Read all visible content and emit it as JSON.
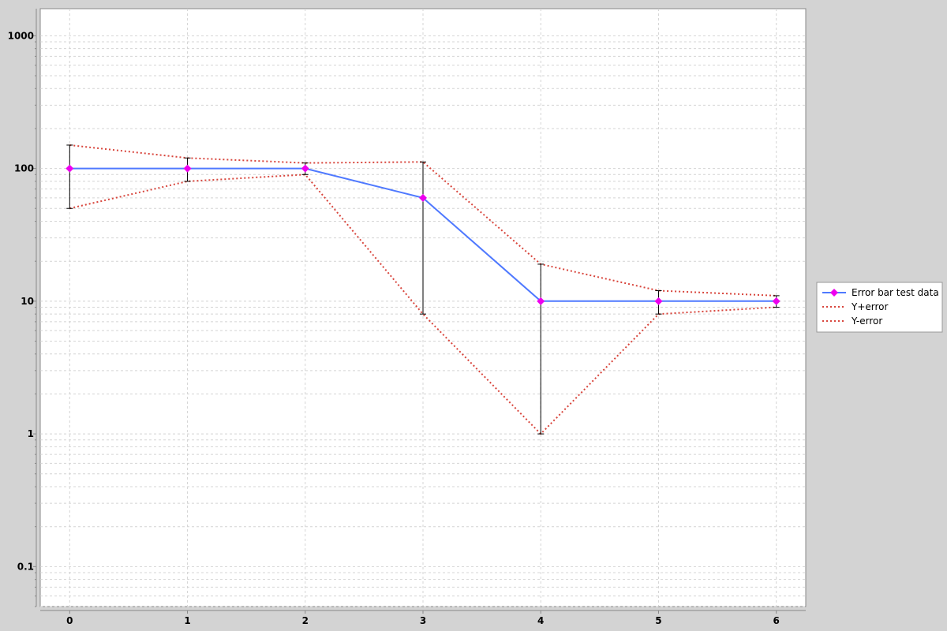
{
  "chart_data": {
    "type": "line",
    "title": "",
    "xlabel": "",
    "ylabel": "",
    "y_scale": "log",
    "xlim": [
      -0.25,
      6.25
    ],
    "ylim": [
      0.05,
      1600
    ],
    "grid": true,
    "legend_placement": "right",
    "x_ticks": [
      "0",
      "1",
      "2",
      "3",
      "4",
      "5",
      "6"
    ],
    "y_ticks": [
      {
        "value": 0.1,
        "label": "0.1"
      },
      {
        "value": 1,
        "label": "1"
      },
      {
        "value": 10,
        "label": "10"
      },
      {
        "value": 100,
        "label": "100"
      },
      {
        "value": 1000,
        "label": "1000"
      }
    ],
    "x": [
      0,
      1,
      2,
      3,
      4,
      5,
      6
    ],
    "series": [
      {
        "name": "Error bar test data",
        "values": [
          100,
          100,
          100,
          60,
          10,
          10,
          10
        ],
        "color": "#4f79ff",
        "style": "solid",
        "marker": "diamond",
        "marker_color": "#ee00ee"
      },
      {
        "name": "Y+error",
        "values": [
          150,
          120,
          110,
          112,
          19,
          12,
          11
        ],
        "color": "#d8453c",
        "style": "dotted"
      },
      {
        "name": "Y-error",
        "values": [
          50,
          80,
          90,
          8,
          1,
          8,
          9
        ],
        "color": "#d8453c",
        "style": "dotted"
      }
    ],
    "error_bars": {
      "upper": [
        150,
        120,
        110,
        112,
        19,
        12,
        11
      ],
      "lower": [
        50,
        80,
        90,
        8,
        1,
        8,
        9
      ],
      "color": "#000000"
    }
  }
}
